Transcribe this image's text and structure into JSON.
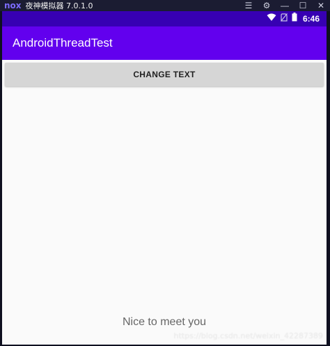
{
  "emulator": {
    "logo": "nox",
    "title": "夜神模拟器 7.0.1.0",
    "controls": {
      "menu": "☰",
      "settings": "⚙",
      "minimize": "—",
      "maximize": "☐",
      "close": "✕"
    }
  },
  "statusbar": {
    "time": "6:46",
    "icons": [
      "wifi-icon",
      "no-sim-icon",
      "battery-icon"
    ]
  },
  "app": {
    "title": "AndroidThreadTest",
    "button_label": "CHANGE TEXT",
    "message": "Nice to meet you"
  },
  "watermark": "https://blog.csdn.net/weixin_42287389",
  "colors": {
    "primary": "#6200ee",
    "primary_dark": "#3700b3",
    "button": "#d6d6d6",
    "background": "#fafafa"
  }
}
